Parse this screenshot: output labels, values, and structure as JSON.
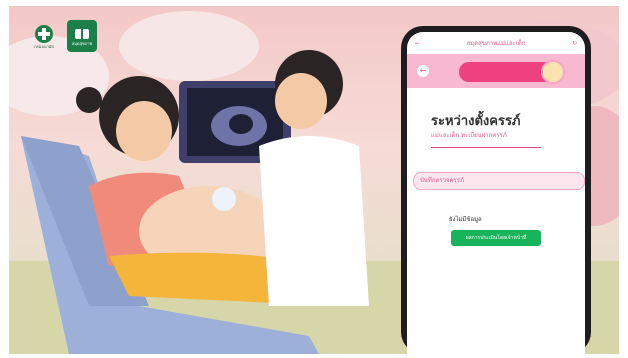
{
  "logos": {
    "moph_label": "กรมอนามัย",
    "app_label": "สมุดสุขภาพ"
  },
  "phone": {
    "topbar_title": "สมุดสุขภาพแม่และเด็ก",
    "status_title": "ระหว่างตั้งครรภ์",
    "subtitle": "แม่และเด็ก ทะเบียนฝากครรภ์",
    "section_label": "บันทึกตรวจครรภ์",
    "no_data": "ยังไม่มีข้อมูล",
    "button_label": "ผลการประเมินโดยเจ้าหน้าที่"
  },
  "colors": {
    "accent_pink": "#f0417f",
    "light_pink": "#f8b8d0",
    "button_green": "#18b45b",
    "app_green": "#1b7f4a"
  }
}
